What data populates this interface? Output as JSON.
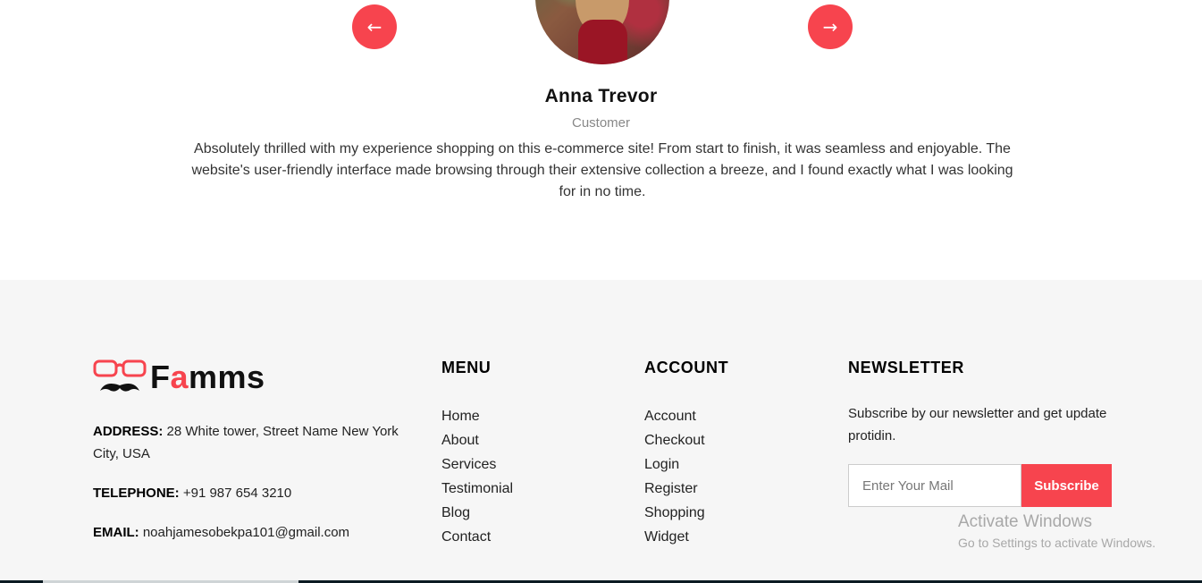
{
  "testimonial": {
    "prev_icon": "arrow-left-icon",
    "next_icon": "arrow-right-icon",
    "prev_glyph": "←",
    "next_glyph": "→",
    "name": "Anna Trevor",
    "role": "Customer",
    "quote": "Absolutely thrilled with my experience shopping on this e-commerce site! From start to finish, it was seamless and enjoyable. The website's user-friendly interface made browsing through their extensive collection a breeze, and I found exactly what I was looking for in no time."
  },
  "footer": {
    "logo": {
      "prefix": "F",
      "accent": "a",
      "suffix": "mms",
      "icon": "glasses-mustache-icon"
    },
    "address_label": "ADDRESS:",
    "address_value": " 28 White tower, Street Name New York City, USA",
    "phone_label": "TELEPHONE:",
    "phone_value": " +91 987 654 3210",
    "email_label": "EMAIL:",
    "email_value": " noahjamesobekpa101@gmail.com",
    "menu": {
      "title": "MENU",
      "items": [
        "Home",
        "About",
        "Services",
        "Testimonial",
        "Blog",
        "Contact"
      ]
    },
    "account": {
      "title": "ACCOUNT",
      "items": [
        "Account",
        "Checkout",
        "Login",
        "Register",
        "Shopping",
        "Widget"
      ]
    },
    "newsletter": {
      "title": "NEWSLETTER",
      "text": "Subscribe by our newsletter and get update protidin.",
      "placeholder": "Enter Your Mail",
      "button_label": "Subscribe"
    }
  },
  "watermark": {
    "line1": "Activate Windows",
    "line2": "Go to Settings to activate Windows."
  },
  "colors": {
    "accent": "#f7444e",
    "footer_bg": "#f6f6f6"
  }
}
